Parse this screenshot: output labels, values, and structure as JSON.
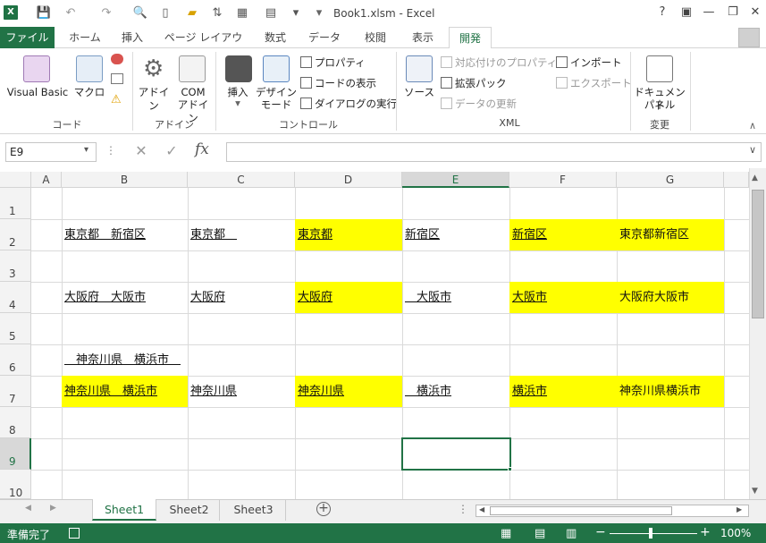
{
  "title": {
    "logo": "X",
    "window_title": "Book1.xlsm - Excel",
    "help": "?"
  },
  "tabs": [
    "ファイル",
    "ホーム",
    "挿入",
    "ページ レイアウト",
    "数式",
    "データ",
    "校閲",
    "表示",
    "開発"
  ],
  "ribbon": {
    "code": {
      "visual_basic": "Visual Basic",
      "macro": "マクロ",
      "group": "コード"
    },
    "addin": {
      "addin": "アドイン",
      "com1": "COM",
      "com2": "アドイン",
      "group": "アドイン"
    },
    "control": {
      "insert": "挿入",
      "design1": "デザイン",
      "design2": "モード",
      "props": "プロパティ",
      "viewcode": "コードの表示",
      "dialog": "ダイアログの実行",
      "group": "コントロール"
    },
    "xml": {
      "source": "ソース",
      "map_props": "対応付けのプロパティ",
      "expansion": "拡張パック",
      "refresh": "データの更新",
      "import": "インポート",
      "export": "エクスポート",
      "group": "XML"
    },
    "modify": {
      "doc1": "ドキュメント",
      "doc2": "パネル",
      "group": "変更"
    }
  },
  "formula": {
    "namebox": "E9",
    "fx": "fx",
    "cancel": "✕",
    "enter": "✓",
    "value": ""
  },
  "columns": [
    "A",
    "B",
    "C",
    "D",
    "E",
    "F",
    "G"
  ],
  "rows": [
    "1",
    "2",
    "3",
    "4",
    "5",
    "6",
    "7",
    "8",
    "9",
    "10"
  ],
  "cells": {
    "B2": "東京都　新宿区",
    "C2": "東京都　",
    "D2": "東京都",
    "E2": "新宿区",
    "F2": "新宿区",
    "G2": "東京都新宿区",
    "B4": "大阪府　大阪市",
    "C4": "大阪府",
    "D4": "大阪府",
    "E4": "　大阪市",
    "F4": "大阪市",
    "G4": "大阪府大阪市",
    "B6": "　神奈川県　横浜市　",
    "B7": "神奈川県　横浜市",
    "C7": "神奈川県",
    "D7": "神奈川県",
    "E7": "　横浜市",
    "F7": "横浜市",
    "G7": "神奈川県横浜市"
  },
  "sheets": [
    "Sheet1",
    "Sheet2",
    "Sheet3"
  ],
  "status": {
    "ready": "準備完了",
    "zoom": "100%",
    "minus": "−",
    "plus": "+"
  },
  "colors": {
    "accent": "#217346",
    "highlight": "#ffff00"
  }
}
